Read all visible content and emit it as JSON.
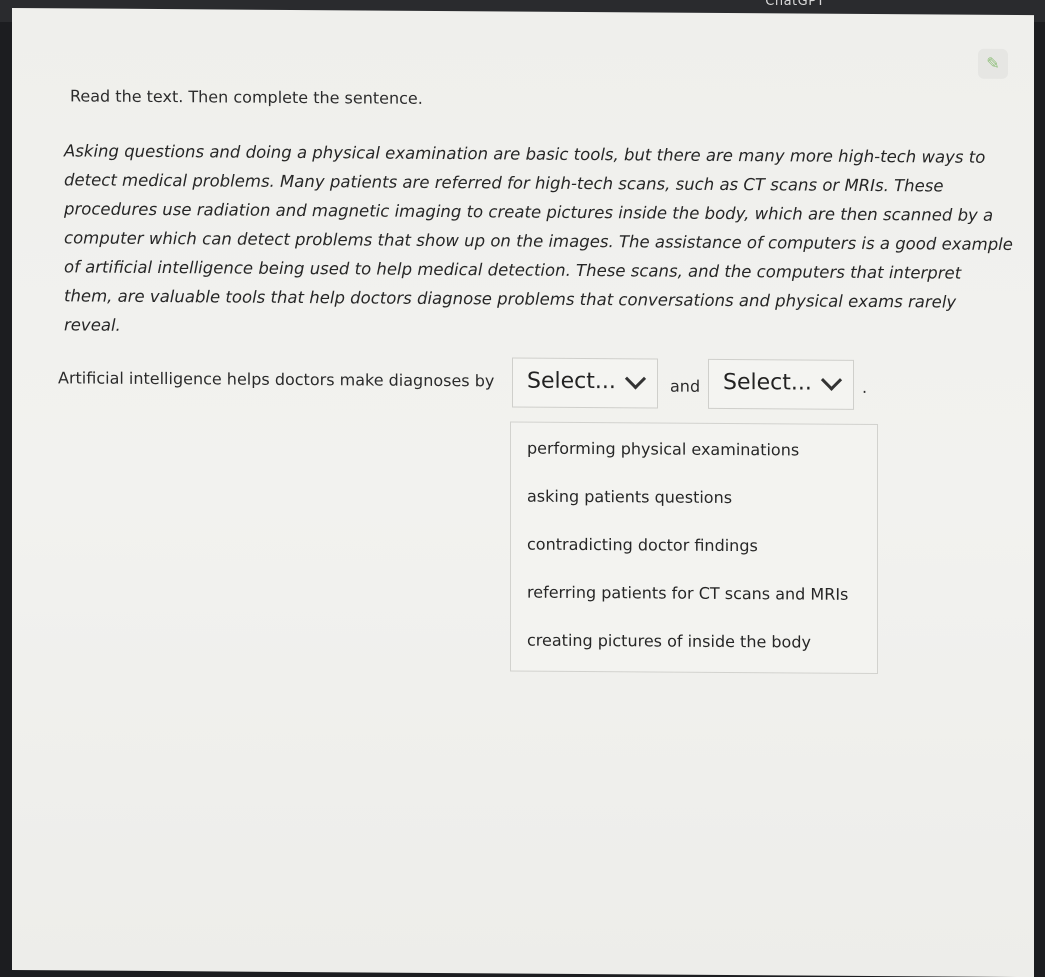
{
  "topbar": {
    "app_label": "ChatGPT"
  },
  "question": {
    "instruction": "Read the text. Then complete the sentence.",
    "passage": "Asking questions and doing a physical examination are basic tools, but there are many more high-tech ways to detect medical problems. Many patients are referred for high-tech scans, such as CT scans or MRIs. These procedures use radiation and magnetic imaging to create pictures inside the body, which are then scanned by a computer which can detect problems that show up on the images. The assistance of computers is a good example of artificial intelligence being used to help medical detection. These scans, and the computers that interpret them, are valuable tools that help doctors diagnose problems that conversations and physical exams rarely reveal."
  },
  "sentence": {
    "prefix": "Artificial intelligence helps doctors make diagnoses by",
    "conjunction": "and",
    "suffix": ".",
    "select1_label": "Select...",
    "select2_label": "Select..."
  },
  "dropdown": {
    "options": [
      "performing physical examinations",
      "asking patients questions",
      "contradicting doctor findings",
      "referring patients for CT scans and MRIs",
      "creating pictures of inside the body"
    ]
  },
  "icons": {
    "edit": "pencil-icon",
    "chevron": "chevron-down-icon"
  }
}
